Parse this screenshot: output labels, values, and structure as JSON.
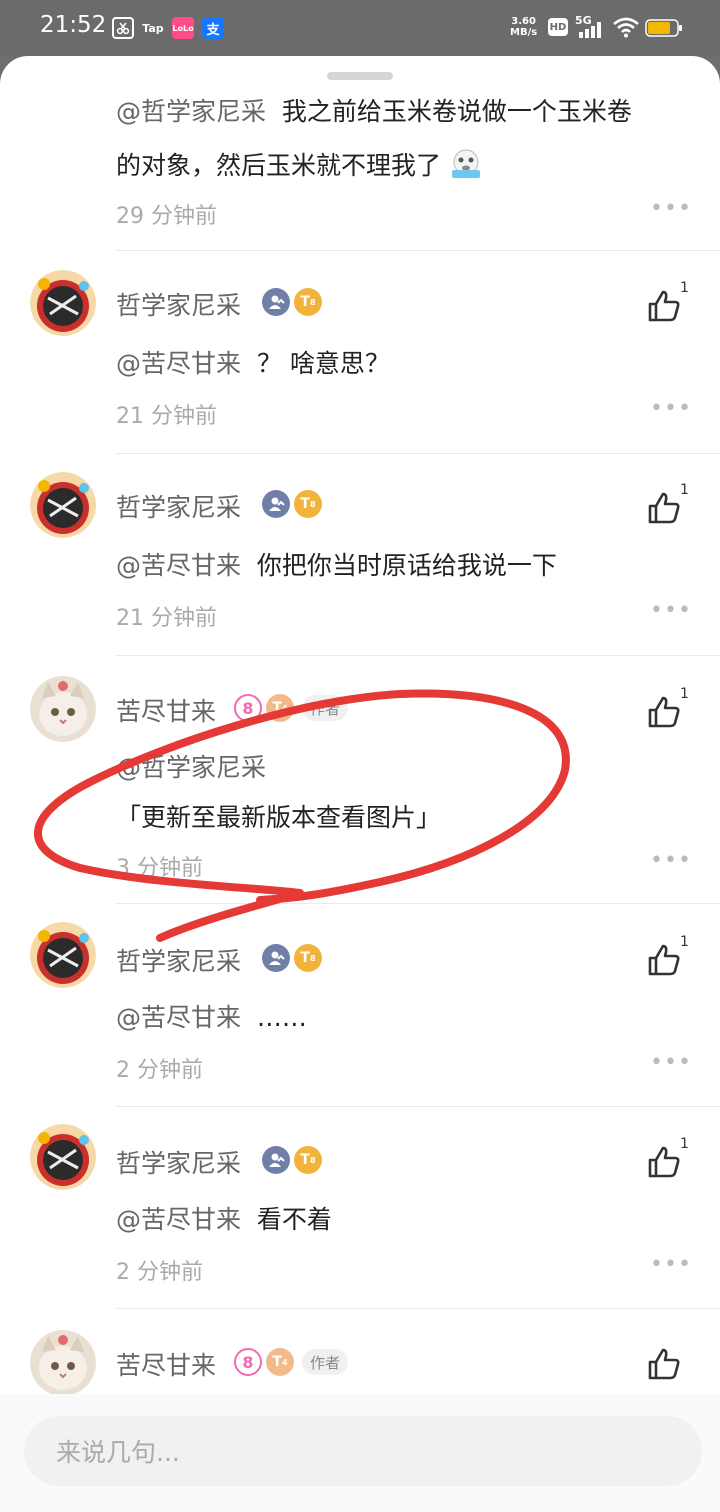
{
  "status_bar": {
    "time": "21:52",
    "speed_value": "3.60",
    "speed_unit": "MB/s",
    "hd_label": "HD",
    "network_label": "5G",
    "app_icon_2": "Tap",
    "app_icon_3": "LoLo",
    "app_icon_4": "支",
    "icons": [
      "scissor-app-icon",
      "taptap-app-icon",
      "lolo-app-icon",
      "alipay-app-icon",
      "signal-icon",
      "wifi-icon",
      "battery-icon"
    ]
  },
  "colors": {
    "accent_red": "#e53935",
    "badge_blue": "#6f7fa8",
    "badge_gold": "#f2b33d",
    "badge_pink": "#f06bb0"
  },
  "comments": [
    {
      "mention": "@哲学家尼采",
      "text_line1": "我之前给玉米卷说做一个玉米卷",
      "text_line2": "的对象，然后玉米就不理我了",
      "emoji": "crying-emoji-icon",
      "time": "29 分钟前"
    },
    {
      "author": "哲学家尼采",
      "mention": "@苦尽甘来",
      "text": "？ 啥意思？",
      "time": "21 分钟前",
      "likes": "1",
      "level": "8"
    },
    {
      "author": "哲学家尼采",
      "mention": "@苦尽甘来",
      "text": "你把你当时原话给我说一下",
      "time": "21 分钟前",
      "likes": "1",
      "level": "8"
    },
    {
      "author": "苦尽甘来",
      "author_tag": "作者",
      "mention": "@哲学家尼采",
      "text": "「更新至最新版本查看图片」",
      "time": "3 分钟前",
      "likes": "1",
      "level": "4",
      "rank": "8"
    },
    {
      "author": "哲学家尼采",
      "mention": "@苦尽甘来",
      "text": "……",
      "time": "2 分钟前",
      "likes": "1",
      "level": "8"
    },
    {
      "author": "哲学家尼采",
      "mention": "@苦尽甘来",
      "text": "看不着",
      "time": "2 分钟前",
      "likes": "1",
      "level": "8"
    },
    {
      "author": "苦尽甘来",
      "author_tag": "作者",
      "level": "4",
      "rank": "8"
    }
  ],
  "more_label": "•••",
  "input": {
    "placeholder": "来说几句..."
  }
}
